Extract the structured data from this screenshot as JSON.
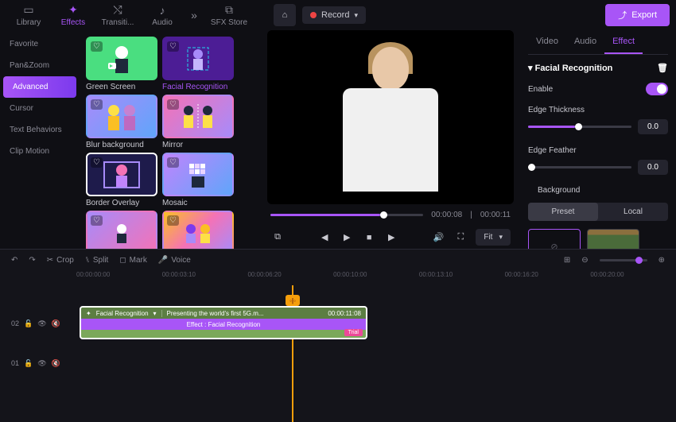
{
  "tabs": {
    "library": "Library",
    "effects": "Effects",
    "transitions": "Transiti...",
    "audio": "Audio",
    "sfx": "SFX Store"
  },
  "record": "Record",
  "export": "Export",
  "sidebar": {
    "items": [
      "Favorite",
      "Pan&Zoom",
      "Advanced",
      "Cursor",
      "Text Behaviors",
      "Clip Motion"
    ]
  },
  "effects": [
    {
      "name": "Green Screen"
    },
    {
      "name": "Facial Recognition",
      "selected": true
    },
    {
      "name": "Blur background"
    },
    {
      "name": "Mirror"
    },
    {
      "name": "Border Overlay",
      "bordered": true
    },
    {
      "name": "Mosaic"
    }
  ],
  "player": {
    "current": "00:00:08",
    "total": "00:00:11",
    "fit": "Fit"
  },
  "rpanel": {
    "tabs": [
      "Video",
      "Audio",
      "Effect"
    ],
    "title": "Facial Recognition",
    "enable": "Enable",
    "edge_thickness": {
      "label": "Edge Thickness",
      "value": "0.0"
    },
    "edge_feather": {
      "label": "Edge Feather",
      "value": "0.0"
    },
    "background": "Background",
    "bg_tabs": [
      "Preset",
      "Local"
    ]
  },
  "tl": {
    "tools": {
      "crop": "Crop",
      "split": "Split",
      "mark": "Mark",
      "voice": "Voice"
    },
    "ticks": [
      "00:00:00:00",
      "00:00:03:10",
      "00:00:06:20",
      "00:00:10:00",
      "00:00:13:10",
      "00:00:16:20",
      "00:00:20:00"
    ],
    "track2": "02",
    "track1": "01",
    "clip": {
      "effect_name": "Facial Recognition",
      "title": "Presenting the world's first 5G.m...",
      "duration": "00:00:11:08",
      "effect_label": "Effect : Facial Recognition",
      "trial": "Trial"
    }
  }
}
